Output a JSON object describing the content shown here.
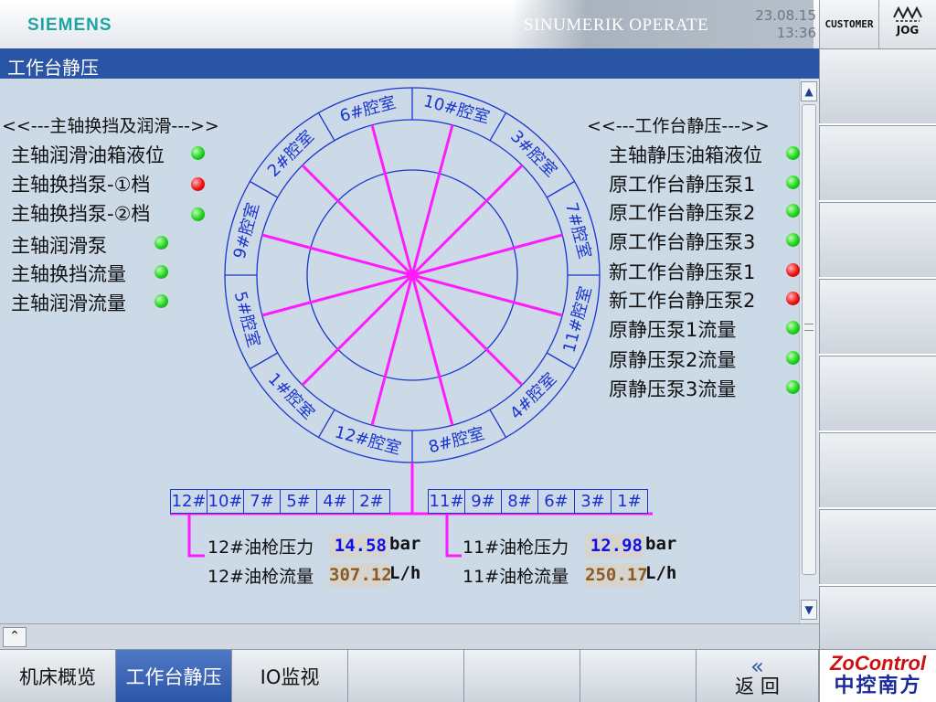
{
  "header": {
    "brand": "SIEMENS",
    "product": "SINUMERIK OPERATE",
    "date": "23.08.15",
    "time": "13:36",
    "customer": "CUSTOMER",
    "mode": "JOG"
  },
  "title": "工作台静压",
  "left_panel": {
    "heading": "<<---主轴换挡及润滑--->>",
    "items": [
      {
        "label": "主轴润滑油箱液位",
        "status": "green"
      },
      {
        "label": "主轴换挡泵-①档",
        "status": "red"
      },
      {
        "label": "主轴换挡泵-②档",
        "status": "green"
      },
      {
        "label": "主轴润滑泵",
        "status": "green"
      },
      {
        "label": "主轴换挡流量",
        "status": "green"
      },
      {
        "label": "主轴润滑流量",
        "status": "green"
      }
    ]
  },
  "right_panel": {
    "heading": "<<---工作台静压--->>",
    "items": [
      {
        "label": "主轴静压油箱液位",
        "status": "green"
      },
      {
        "label": "原工作台静压泵1",
        "status": "green"
      },
      {
        "label": "原工作台静压泵2",
        "status": "green"
      },
      {
        "label": "原工作台静压泵3",
        "status": "green"
      },
      {
        "label": "新工作台静压泵1",
        "status": "red"
      },
      {
        "label": "新工作台静压泵2",
        "status": "red"
      },
      {
        "label": "原静压泵1流量",
        "status": "green"
      },
      {
        "label": "原静压泵2流量",
        "status": "green"
      },
      {
        "label": "原静压泵3流量",
        "status": "green"
      }
    ]
  },
  "chambers": [
    "6#腔室",
    "10#腔室",
    "3#腔室",
    "7#腔室",
    "11#腔室",
    "4#腔室",
    "8#腔室",
    "12#腔室",
    "1#腔室",
    "5#腔室",
    "9#腔室",
    "2#腔室"
  ],
  "left_group": [
    "12#",
    "10#",
    "7#",
    "5#",
    "4#",
    "2#"
  ],
  "right_group": [
    "11#",
    "9#",
    "8#",
    "6#",
    "3#",
    "1#"
  ],
  "readouts": {
    "p12_label": "12#油枪压力",
    "p12_value": "14.58",
    "p12_unit": "bar",
    "f12_label": "12#油枪流量",
    "f12_value": "307.12",
    "f12_unit": "L/h",
    "p11_label": "11#油枪压力",
    "p11_value": "12.98",
    "p11_unit": "bar",
    "f11_label": "11#油枪流量",
    "f11_value": "250.17",
    "f11_unit": "L/h"
  },
  "softkeys": {
    "sk1": "机床概览",
    "sk2": "工作台静压",
    "sk3": "IO监视",
    "back": "返 回",
    "back_icon": "«"
  },
  "logo": {
    "line1": "ZoControl",
    "line2": "中控南方"
  },
  "colors": {
    "accent": "#2a55a5",
    "ring": "#1a35d0",
    "spoke": "#ff1aff",
    "value_blue": "#1010ee",
    "value_brown": "#8a5a28"
  }
}
